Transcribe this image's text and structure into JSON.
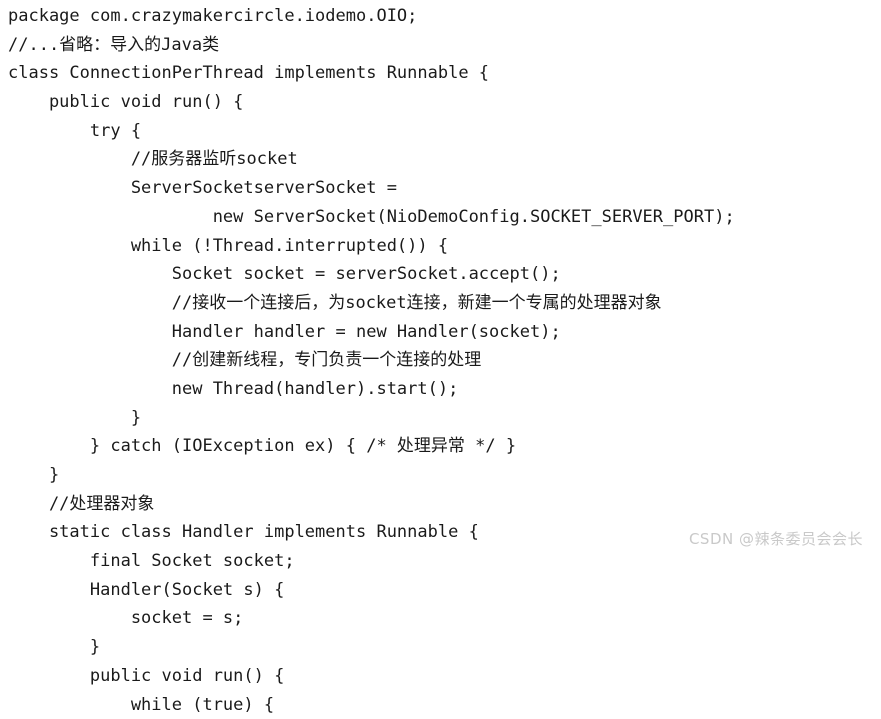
{
  "document": {
    "kind": "code-snippet",
    "language": "Java",
    "background_color": "#ffffff",
    "text_color": "#1a1a1a",
    "code_lines": [
      "package com.crazymakercircle.iodemo.OIO;",
      "//...省略：导入的Java类",
      "class ConnectionPerThread implements Runnable {",
      "    public void run() {",
      "        try {",
      "            //服务器监听socket",
      "            ServerSocketserverSocket =",
      "                    new ServerSocket(NioDemoConfig.SOCKET_SERVER_PORT);",
      "            while (!Thread.interrupted()) {",
      "                Socket socket = serverSocket.accept();",
      "                //接收一个连接后，为socket连接，新建一个专属的处理器对象",
      "                Handler handler = new Handler(socket);",
      "                //创建新线程，专门负责一个连接的处理",
      "                new Thread(handler).start();",
      "            }",
      "        } catch (IOException ex) { /* 处理异常 */ }",
      "    }",
      "    //处理器对象",
      "    static class Handler implements Runnable {",
      "        final Socket socket;",
      "        Handler(Socket s) {",
      "            socket = s;",
      "        }",
      "        public void run() {",
      "            while (true) {"
    ]
  },
  "watermark": {
    "text": "CSDN @辣条委员会会长",
    "color": "#c9c9c9"
  }
}
